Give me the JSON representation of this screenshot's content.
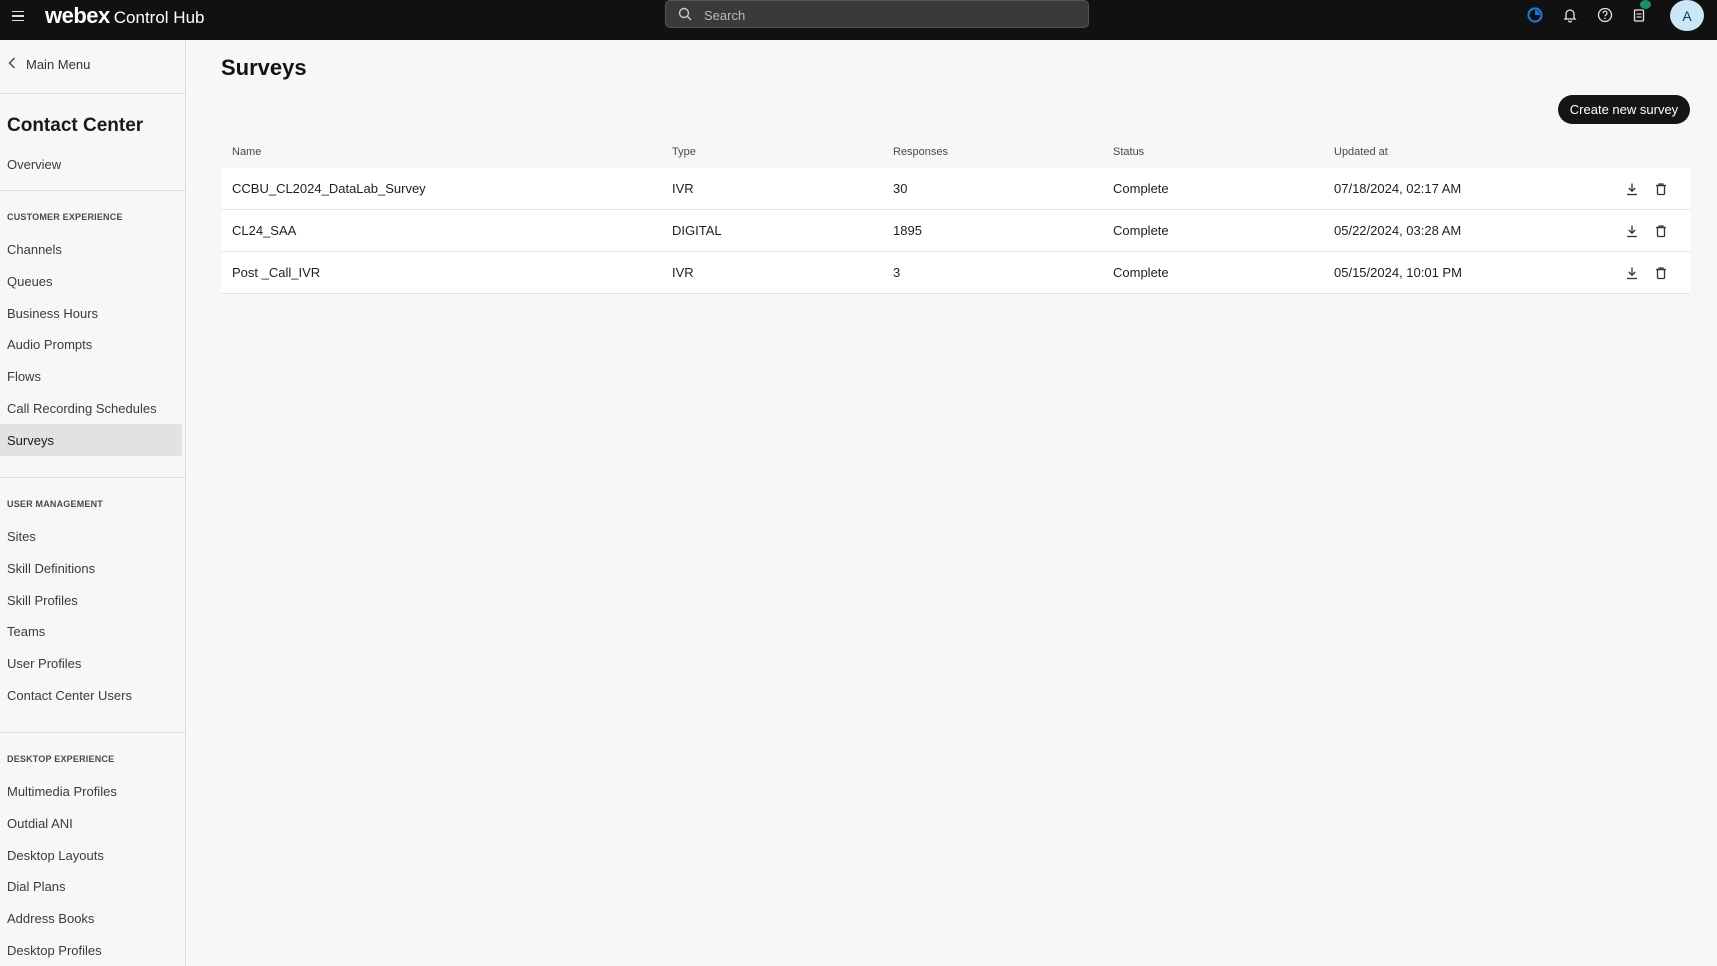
{
  "topbar": {
    "brand": "webex",
    "product": "Control Hub",
    "search_placeholder": "Search",
    "avatar_initial": "A"
  },
  "sidebar": {
    "back_label": "Main Menu",
    "title": "Contact Center",
    "overview": "Overview",
    "sections": [
      {
        "heading": "CUSTOMER EXPERIENCE",
        "items": [
          "Channels",
          "Queues",
          "Business Hours",
          "Audio Prompts",
          "Flows",
          "Call Recording Schedules",
          "Surveys"
        ]
      },
      {
        "heading": "USER MANAGEMENT",
        "items": [
          "Sites",
          "Skill Definitions",
          "Skill Profiles",
          "Teams",
          "User Profiles",
          "Contact Center Users"
        ]
      },
      {
        "heading": "DESKTOP EXPERIENCE",
        "items": [
          "Multimedia Profiles",
          "Outdial ANI",
          "Desktop Layouts",
          "Dial Plans",
          "Address Books",
          "Desktop Profiles"
        ]
      }
    ],
    "active_item": "Surveys"
  },
  "main": {
    "title": "Surveys",
    "create_button": "Create new survey",
    "table": {
      "columns": [
        "Name",
        "Type",
        "Responses",
        "Status",
        "Updated at"
      ],
      "rows": [
        [
          "CCBU_CL2024_DataLab_Survey",
          "IVR",
          "30",
          "Complete",
          "07/18/2024, 02:17 AM"
        ],
        [
          "CL24_SAA",
          "DIGITAL",
          "1895",
          "Complete",
          "05/22/2024, 03:28 AM"
        ],
        [
          "Post _Call_IVR",
          "IVR",
          "3",
          "Complete",
          "05/15/2024, 10:01 PM"
        ]
      ]
    }
  },
  "colors": {
    "topbar_bg": "#111111",
    "accent_dark": "#151515",
    "active_item_bg": "#e2e2e2",
    "sync_blue": "#1e73d6",
    "check_green": "#1a8f6e"
  }
}
